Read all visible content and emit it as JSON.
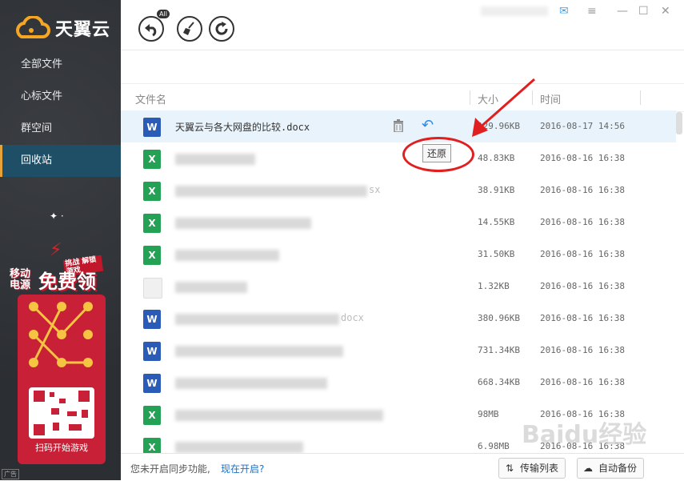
{
  "app": {
    "name": "天翼云"
  },
  "sidebar": {
    "items": [
      {
        "label": "全部文件"
      },
      {
        "label": "心标文件"
      },
      {
        "label": "群空间"
      },
      {
        "label": "回收站"
      }
    ],
    "promo": {
      "top_left": "移动",
      "top_left2": "电源",
      "tag": "挑战 解锁游戏",
      "headline": "免费领",
      "qr_caption": "扫码开始游戏",
      "ad_label": "广告"
    }
  },
  "toolbar": {
    "restore_all_badge": "All"
  },
  "table": {
    "headers": {
      "name": "文件名",
      "size": "大小",
      "time": "时间"
    },
    "tooltip": "还原",
    "rows": [
      {
        "type": "word",
        "name": "天翼云与各大网盘的比较.docx",
        "size": "129.96KB",
        "time": "2016-08-17 14:56"
      },
      {
        "type": "excel",
        "name": "",
        "size": "48.83KB",
        "time": "2016-08-16 16:38"
      },
      {
        "type": "excel",
        "name": "sx",
        "size": "38.91KB",
        "time": "2016-08-16 16:38"
      },
      {
        "type": "excel",
        "name": "",
        "size": "14.55KB",
        "time": "2016-08-16 16:38"
      },
      {
        "type": "excel",
        "name": "",
        "size": "31.50KB",
        "time": "2016-08-16 16:38"
      },
      {
        "type": "blank",
        "name": "",
        "size": "1.32KB",
        "time": "2016-08-16 16:38"
      },
      {
        "type": "word",
        "name": "docx",
        "size": "380.96KB",
        "time": "2016-08-16 16:38"
      },
      {
        "type": "word",
        "name": "",
        "size": "731.34KB",
        "time": "2016-08-16 16:38"
      },
      {
        "type": "word",
        "name": "",
        "size": "668.34KB",
        "time": "2016-08-16 16:38"
      },
      {
        "type": "excel",
        "name": "",
        "size": "98MB",
        "time": "2016-08-16 16:38"
      },
      {
        "type": "excel",
        "name": "",
        "size": "6.98MB",
        "time": "2016-08-16 16:38"
      }
    ]
  },
  "footer": {
    "sync_text": "您未开启同步功能,",
    "sync_link": "现在开启?",
    "transfer_label": "传输列表",
    "backup_label": "自动备份"
  },
  "watermark": "Baidu经验",
  "colors": {
    "sidebar": "#2f3237",
    "active": "#1e4f66",
    "link": "#1f6fc5",
    "annotation": "#e02020"
  }
}
